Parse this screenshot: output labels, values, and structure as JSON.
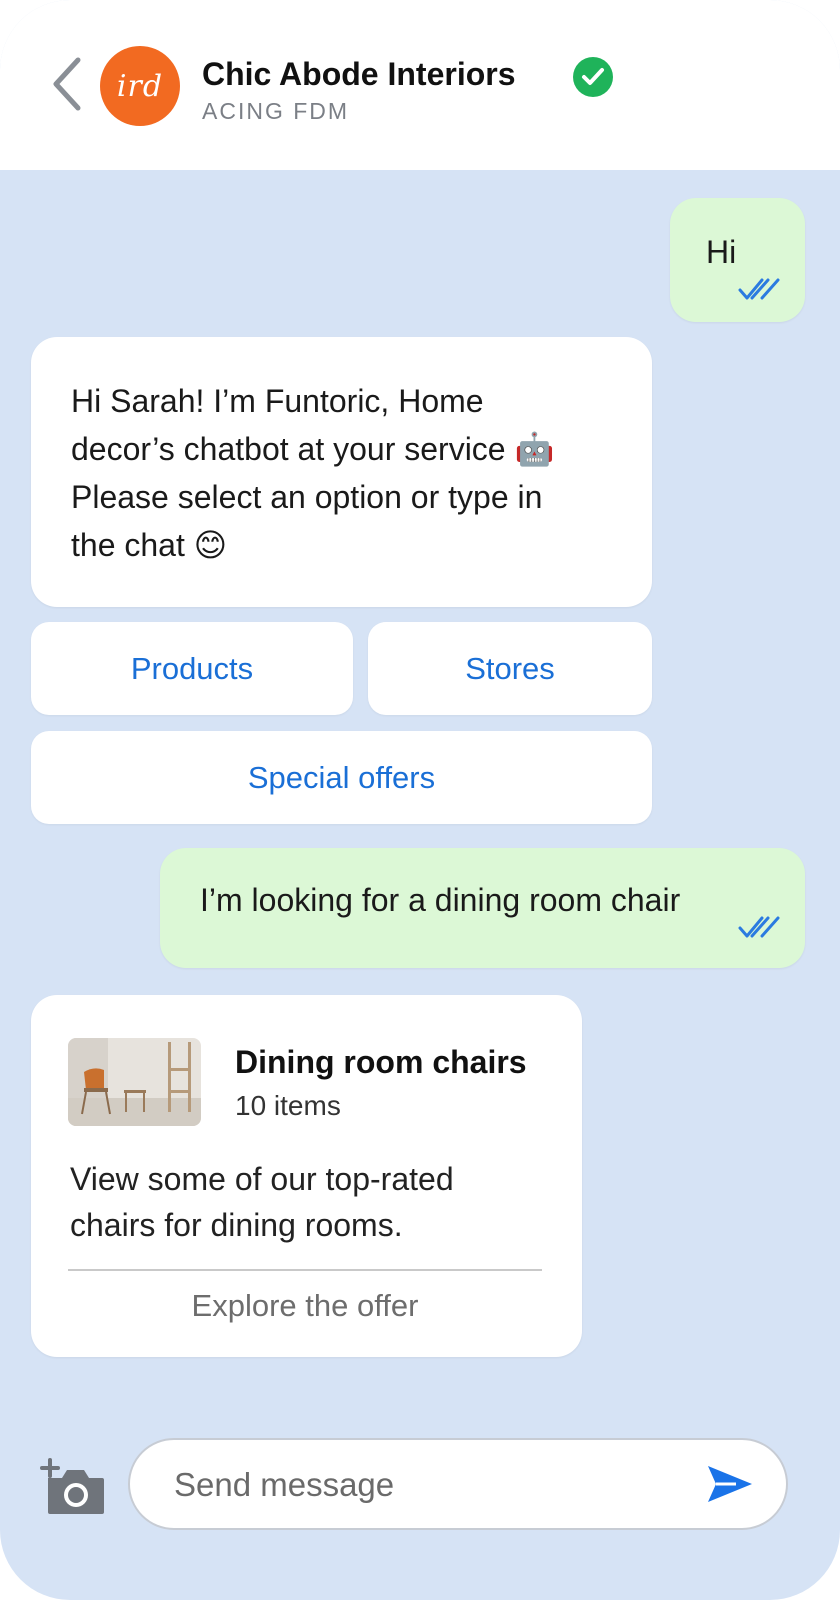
{
  "header": {
    "title": "Chic Abode Interiors",
    "subtitle": "ACING FDM",
    "avatar_text": "ird",
    "verified_icon": "verified-check-icon",
    "back_icon": "chevron-left-icon"
  },
  "messages": {
    "m1": {
      "text": "Hi",
      "status": "read"
    },
    "m2": {
      "line1": "Hi Sarah! I’m Funtoric, Home",
      "line2": "decor’s chatbot at your service 🤖",
      "line3": "Please select an option or type in",
      "line4": "the chat 😊"
    },
    "m3": {
      "text": "I’m looking for a dining room chair",
      "status": "read"
    }
  },
  "options": {
    "products": "Products",
    "stores": "Stores",
    "special_offers": "Special offers"
  },
  "card": {
    "title": "Dining room chairs",
    "count": "10 items",
    "desc_line1": "View some of our top-rated",
    "desc_line2": "chairs for dining rooms.",
    "cta": "Explore the offer"
  },
  "composer": {
    "placeholder": "Send message",
    "camera_icon": "add-photo-camera-icon",
    "send_icon": "send-icon"
  },
  "colors": {
    "chat_bg": "#d6e3f5",
    "outgoing_bubble": "#dcf8d6",
    "incoming_bubble": "#ffffff",
    "link_blue": "#1a6fd6",
    "avatar_orange": "#f26a21",
    "verified_green": "#1fb35a"
  }
}
